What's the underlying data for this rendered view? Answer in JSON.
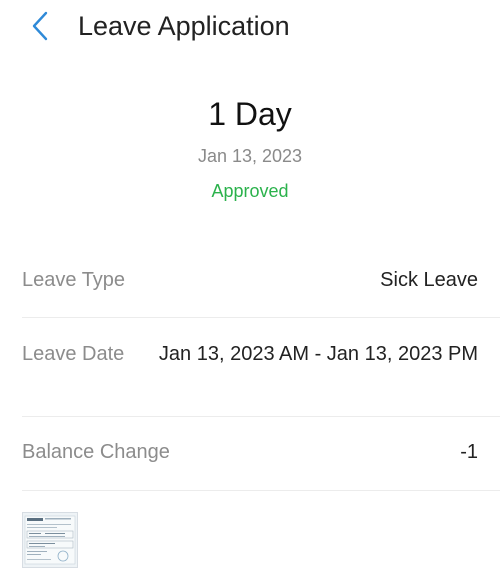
{
  "header": {
    "back_icon": "chevron-left-icon",
    "title": "Leave Application",
    "accent_color": "#2f8ad8"
  },
  "summary": {
    "duration": "1 Day",
    "date": "Jan 13, 2023",
    "status": "Approved",
    "status_color": "#2bb24c"
  },
  "details": [
    {
      "label": "Leave Type",
      "value": "Sick Leave"
    },
    {
      "label": "Leave Date",
      "value": "Jan 13, 2023 AM - Jan 13, 2023 PM"
    },
    {
      "label": "Balance Change",
      "value": "-1"
    }
  ],
  "attachment": {
    "icon": "document-thumbnail"
  }
}
